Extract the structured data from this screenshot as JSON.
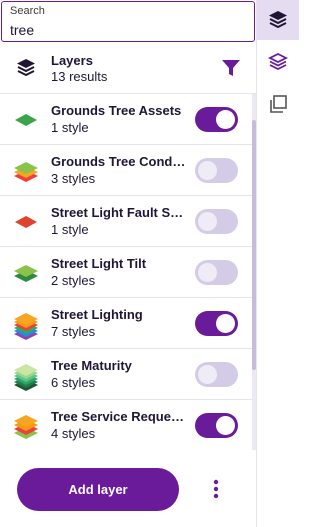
{
  "search": {
    "label": "Search",
    "value": "tree"
  },
  "header": {
    "title": "Layers",
    "count": "13 results"
  },
  "layers": [
    {
      "name": "Grounds Tree Assets",
      "styles": "1 style",
      "icon": "green-diamond-icon",
      "enabled": true
    },
    {
      "name": "Grounds Tree Conditi…",
      "styles": "3 styles",
      "icon": "multi-style-stack-icon",
      "enabled": false
    },
    {
      "name": "Street Light Fault Sta…",
      "styles": "1 style",
      "icon": "red-diamond-icon",
      "enabled": false
    },
    {
      "name": "Street Light Tilt",
      "styles": "2 styles",
      "icon": "green-stack-icon",
      "enabled": false
    },
    {
      "name": "Street Lighting",
      "styles": "7 styles",
      "icon": "multi-style-stack-icon",
      "enabled": true
    },
    {
      "name": "Tree Maturity",
      "styles": "6 styles",
      "icon": "green-stack-icon",
      "enabled": false
    },
    {
      "name": "Tree Service Requests",
      "styles": "4 styles",
      "icon": "multi-style-stack-icon",
      "enabled": true
    }
  ],
  "footer": {
    "add_label": "Add layer"
  },
  "colors": {
    "accent": "#6a1b9a",
    "toggle_off": "#d4cce6"
  }
}
